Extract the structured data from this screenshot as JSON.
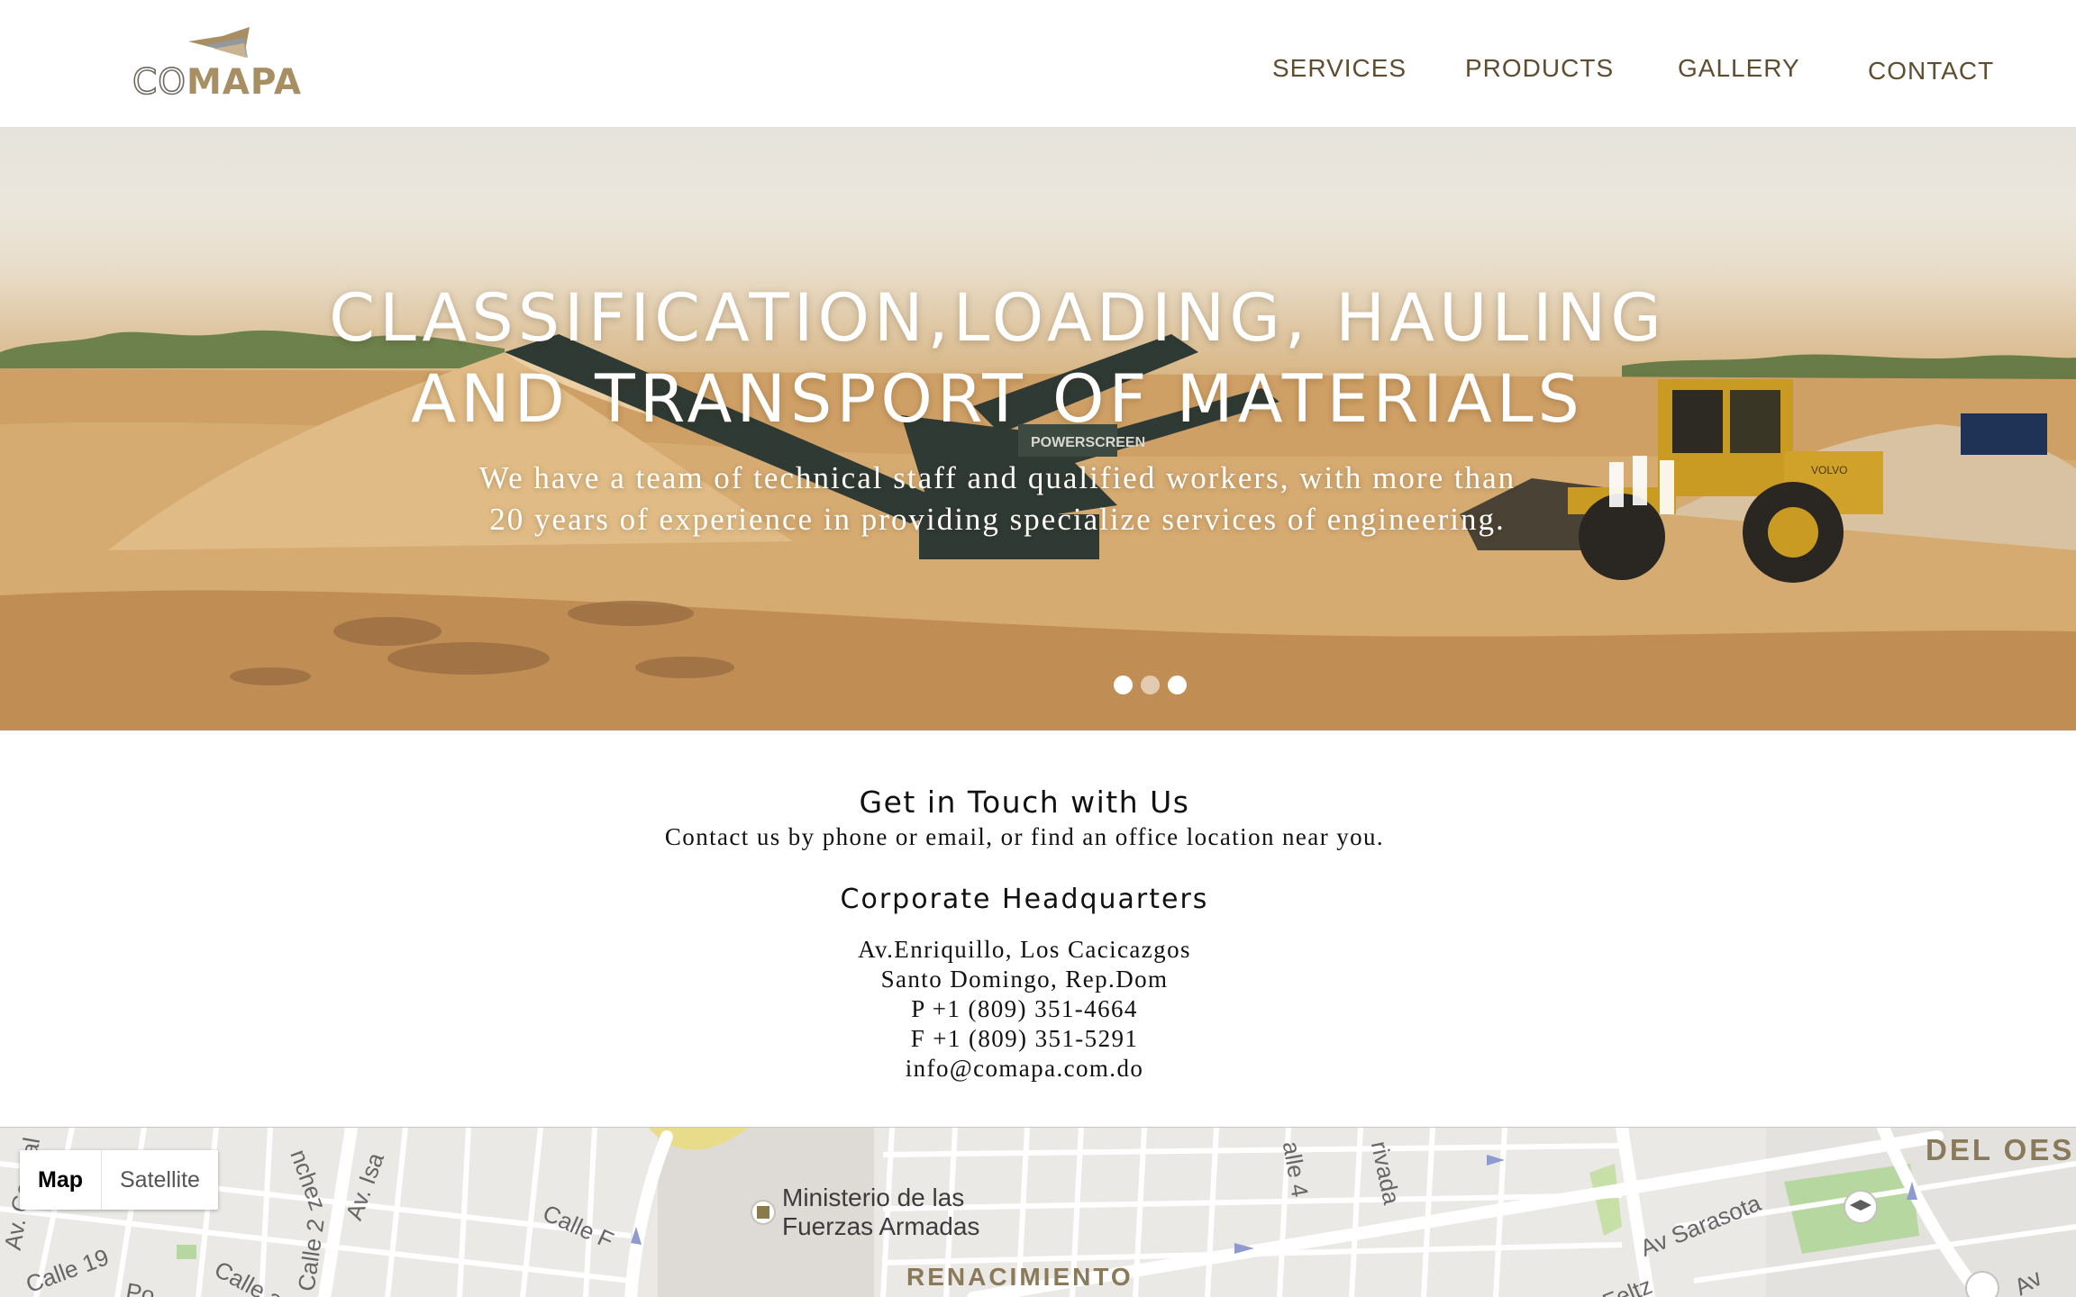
{
  "header": {
    "logo": {
      "part1": "CO",
      "part2": "MAPA"
    },
    "nav": [
      {
        "label": "SERVICES"
      },
      {
        "label": "PRODUCTS"
      },
      {
        "label": "GALLERY"
      },
      {
        "label": "CONTACT"
      }
    ],
    "colors": {
      "nav": "#5e4d30",
      "brand_gold": "#a88e63"
    }
  },
  "hero": {
    "title_line1": "CLASSIFICATION,LOADING, HAULING",
    "title_line2": "AND TRANSPORT OF MATERIALS",
    "subtitle_line1": "We have a team of technical staff and qualified workers, with more than",
    "subtitle_line2": "20 years of experience in providing specialize services of engineering.",
    "machine_label": "POWERSCREEN",
    "loader_label": "VOLVO",
    "slides": {
      "count": 3,
      "active": 2
    }
  },
  "contact": {
    "title": "Get in Touch with Us",
    "lead": "Contact us by phone or email, or find an office location near you.",
    "hq_title": "Corporate Headquarters",
    "address_line1": "Av.Enriquillo, Los Cacicazgos",
    "address_line2": "Santo Domingo, Rep.Dom",
    "phone": "P +1 (809) 351-4664",
    "fax": "F +1 (809) 351-5291",
    "email": "info@comapa.com.do"
  },
  "map": {
    "type_buttons": [
      "Map",
      "Satellite"
    ],
    "active_type": "Map",
    "poi_line1": "Ministerio de las",
    "poi_line2": "Fuerzas Armadas",
    "district_1": "RENACIMIENTO",
    "district_2": "DEL OES",
    "streets": {
      "calle_f": "Calle F",
      "av_isa": "Av. Isa",
      "nchez": "nchez",
      "calle_2": "Calle 2",
      "calle_19": "Calle 19",
      "calle_a": "Calle a",
      "av_central": "Av. Central",
      "calle_4": "alle 4",
      "privada": "rivada",
      "av_sarasota": "Av Sarasota",
      "feltz": "Feltz",
      "po": "Po",
      "av_edge": "Av"
    },
    "icons": [
      "poi-marker-icon",
      "school-icon",
      "road-arrow-icon"
    ]
  }
}
